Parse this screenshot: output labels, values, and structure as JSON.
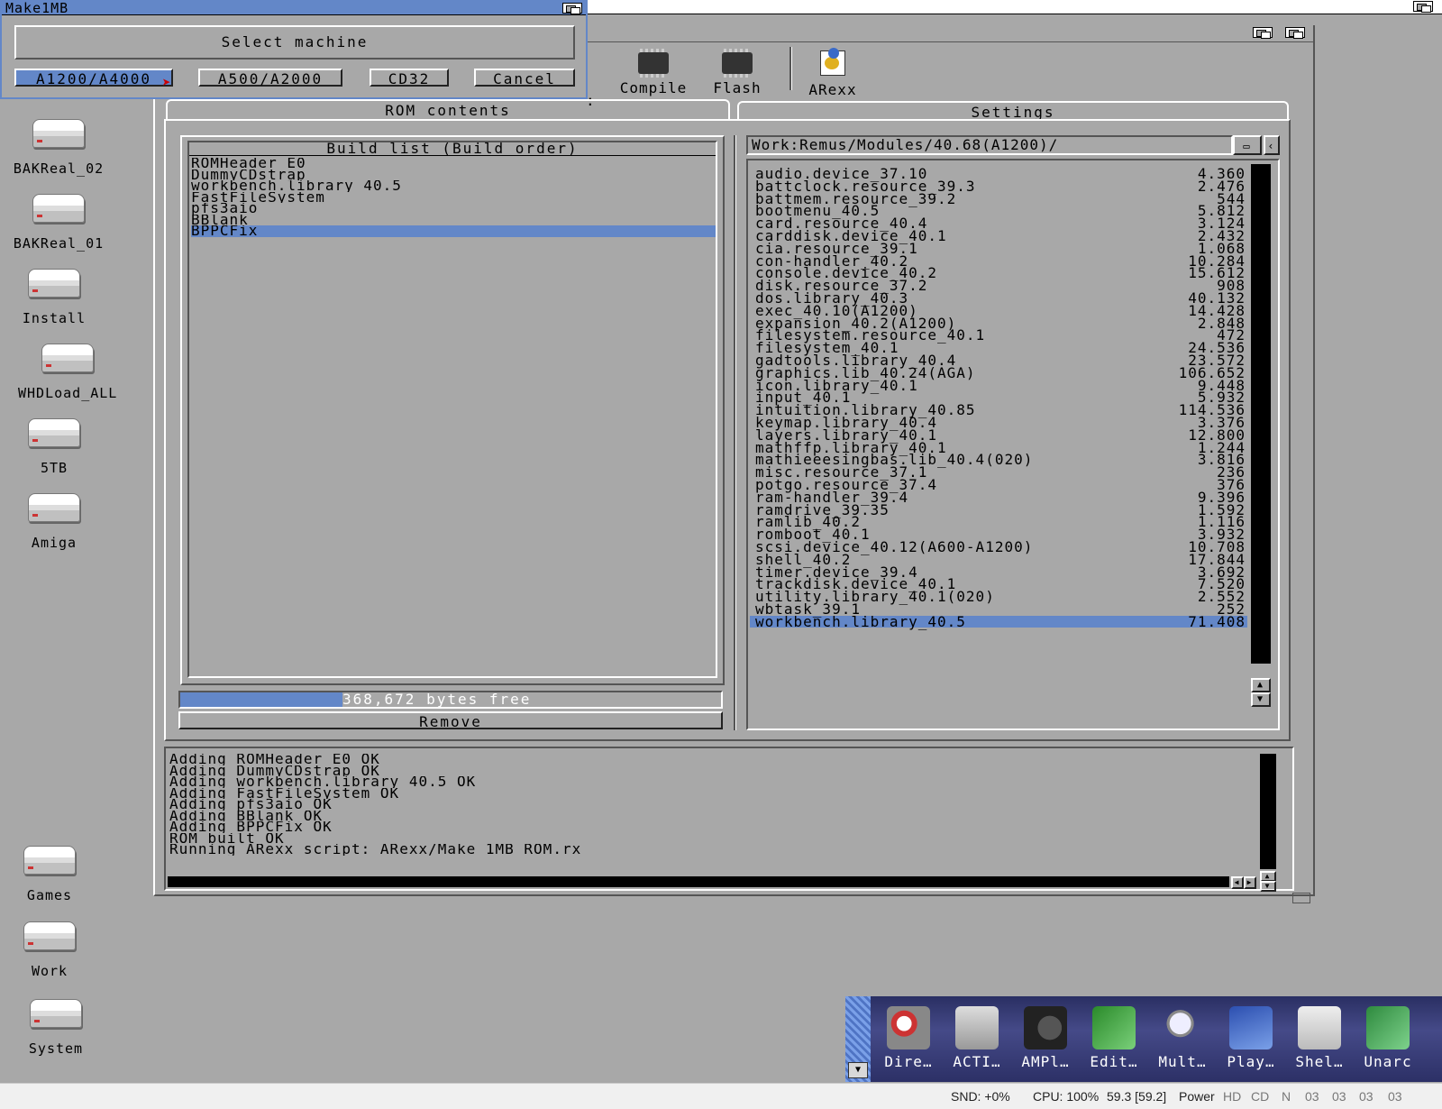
{
  "screen": {
    "title": ""
  },
  "desktop": {
    "icons": [
      {
        "label": "BAKReal_02"
      },
      {
        "label": "BAKReal_01"
      },
      {
        "label": "Install"
      },
      {
        "label": "WHDLoad_ALL"
      },
      {
        "label": "5TB"
      },
      {
        "label": "Amiga"
      },
      {
        "label": "Games"
      },
      {
        "label": "Work"
      },
      {
        "label": "System"
      }
    ]
  },
  "toolbar": {
    "compile_label": "Compile",
    "flash_label": "Flash",
    "arexx_label": "ARexx",
    "compile_cut": ":"
  },
  "tabs": {
    "rom_contents": "ROM contents",
    "settings": "Settings"
  },
  "build_list": {
    "header": "Build list (Build order)",
    "items": [
      "ROMHeader_E0",
      "DummyCDstrap",
      "workbench.library_40.5",
      "FastFileSystem",
      "pfs3aio",
      "BBlank",
      "BPPCFix"
    ],
    "selected_index": 6,
    "free_text": "368,672 bytes free",
    "free_fraction": 0.3,
    "remove_label": "Remove"
  },
  "modules": {
    "path": "Work:Remus/Modules/40.68(A1200)/",
    "rows": [
      {
        "name": "audio.device_37.10",
        "size": "4.360"
      },
      {
        "name": "battclock.resource_39.3",
        "size": "2.476"
      },
      {
        "name": "battmem.resource_39.2",
        "size": "544"
      },
      {
        "name": "bootmenu_40.5",
        "size": "5.812"
      },
      {
        "name": "card.resource_40.4",
        "size": "3.124"
      },
      {
        "name": "carddisk.device_40.1",
        "size": "2.432"
      },
      {
        "name": "cia.resource_39.1",
        "size": "1.068"
      },
      {
        "name": "con-handler_40.2",
        "size": "10.284"
      },
      {
        "name": "console.device_40.2",
        "size": "15.612"
      },
      {
        "name": "disk.resource_37.2",
        "size": "908"
      },
      {
        "name": "dos.library_40.3",
        "size": "40.132"
      },
      {
        "name": "exec_40.10(A1200)",
        "size": "14.428"
      },
      {
        "name": "expansion_40.2(A1200)",
        "size": "2.848"
      },
      {
        "name": "filesystem.resource_40.1",
        "size": "472"
      },
      {
        "name": "filesystem_40.1",
        "size": "24.536"
      },
      {
        "name": "gadtools.library_40.4",
        "size": "23.572"
      },
      {
        "name": "graphics.lib_40.24(AGA)",
        "size": "106.652"
      },
      {
        "name": "icon.library_40.1",
        "size": "9.448"
      },
      {
        "name": "input_40.1",
        "size": "5.932"
      },
      {
        "name": "intuition.library_40.85",
        "size": "114.536"
      },
      {
        "name": "keymap.library_40.4",
        "size": "3.376"
      },
      {
        "name": "layers.library_40.1",
        "size": "12.800"
      },
      {
        "name": "mathffp.library_40.1",
        "size": "1.244"
      },
      {
        "name": "mathieeesingbas.lib_40.4(020)",
        "size": "3.816"
      },
      {
        "name": "misc.resource_37.1",
        "size": "236"
      },
      {
        "name": "potgo.resource_37.4",
        "size": "376"
      },
      {
        "name": "ram-handler_39.4",
        "size": "9.396"
      },
      {
        "name": "ramdrive_39.35",
        "size": "1.592"
      },
      {
        "name": "ramlib_40.2",
        "size": "1.116"
      },
      {
        "name": "romboot_40.1",
        "size": "3.932"
      },
      {
        "name": "scsi.device_40.12(A600-A1200)",
        "size": "10.708"
      },
      {
        "name": "shell_40.2",
        "size": "17.844"
      },
      {
        "name": "timer.device_39.4",
        "size": "3.692"
      },
      {
        "name": "trackdisk.device_40.1",
        "size": "7.520"
      },
      {
        "name": "utility.library_40.1(020)",
        "size": "2.552"
      },
      {
        "name": "wbtask_39.1",
        "size": "252"
      },
      {
        "name": "workbench.library_40.5",
        "size": "71.408"
      }
    ],
    "selected_index": 36
  },
  "log": {
    "lines": [
      "Adding ROMHeader_E0 OK",
      "Adding DummyCDstrap OK",
      "Adding workbench.library_40.5 OK",
      "Adding FastFileSystem OK",
      "Adding pfs3aio OK",
      "Adding BBlank OK",
      "Adding BPPCFix OK",
      "ROM built OK",
      "Running ARexx script: ARexx/Make_1MB_ROM.rx"
    ]
  },
  "requester": {
    "window_title": "Make1MB",
    "message": "Select machine",
    "buttons": [
      "A1200/A4000",
      "A500/A2000",
      "CD32",
      "Cancel"
    ]
  },
  "dock": {
    "items": [
      {
        "label": "Dire…",
        "icon": "directory-opus-icon"
      },
      {
        "label": "ACTI…",
        "icon": "activity-icon"
      },
      {
        "label": "AMPl…",
        "icon": "speaker-icon"
      },
      {
        "label": "Edit…",
        "icon": "notepad-icon"
      },
      {
        "label": "Mult…",
        "icon": "magnifier-icon"
      },
      {
        "label": "Play…",
        "icon": "player-icon"
      },
      {
        "label": "Shel…",
        "icon": "shell-icon"
      },
      {
        "label": "Unarc",
        "icon": "unarc-box-icon"
      }
    ]
  },
  "statusbar": {
    "snd": "SND: +0%",
    "cpu": "CPU: 100%",
    "fps": "59.3 [59.2]",
    "power": "Power",
    "hd": "HD",
    "cd": "CD",
    "n": "N",
    "df0": "03",
    "df1": "03",
    "df2": "03",
    "df3": "03"
  },
  "colors": {
    "desktop": "#a8a8a8",
    "highlight": "#6387c8",
    "dock": "#3a3f7a"
  }
}
